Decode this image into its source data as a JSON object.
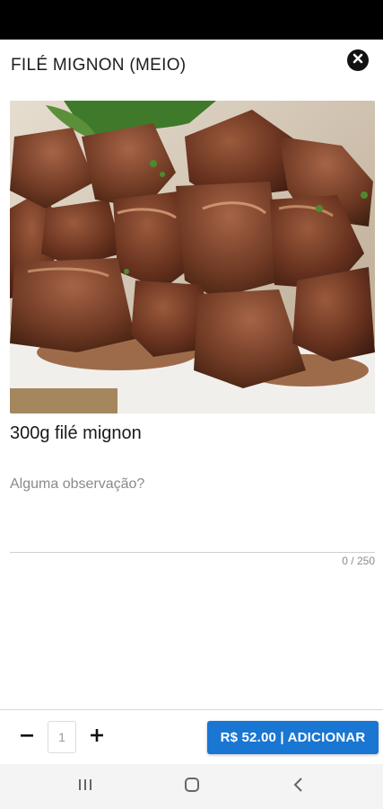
{
  "dialog": {
    "title": "FILÉ MIGNON (MEIO)",
    "close_icon": "close-circle-icon"
  },
  "product": {
    "image_alt": "meat-photo",
    "description": "300g filé mignon"
  },
  "observation": {
    "placeholder": "Alguma observação?",
    "value": "",
    "counter": "0 / 250"
  },
  "footer": {
    "minus_icon": "minus-icon",
    "plus_icon": "plus-icon",
    "quantity": "1",
    "add_button_label": "R$ 52.00 | ADICIONAR",
    "accent_color": "#1976d2"
  },
  "system_nav": {
    "recents_icon": "recents-icon",
    "home_icon": "home-icon",
    "back_icon": "back-icon"
  }
}
